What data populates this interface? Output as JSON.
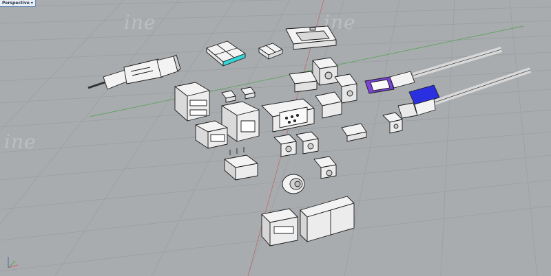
{
  "viewport": {
    "label": "Perspective",
    "menu_icon": "chevron-down-icon",
    "background": "#a9acaf",
    "grid_color": "#9a9da0",
    "x_axis_color": "#b86a6a",
    "y_axis_color": "#5ea45e"
  },
  "watermark": {
    "text": "ine"
  },
  "scene": {
    "objects": [
      "usb-a-plug-cable",
      "micro-sd-card",
      "sd-card-slot",
      "hdmi-receptacle",
      "dc-barrel-jack",
      "usb-a-dual-stack-receptacle",
      "micro-usb-receptacle",
      "rj45-jack",
      "vga-db15-connector",
      "hdmi-port",
      "usb-c-cable-purple",
      "usb-c-cable-blue",
      "usb-a-receptacle",
      "usb-a-through-hole-receptacle",
      "audio-jack",
      "toroidal-inductor",
      "usb-c-receptacle",
      "usb-mini-receptacle",
      "vertical-usb-receptacle",
      "pcie-edge-connector"
    ],
    "accent_cyan": "#35d5d8",
    "accent_purple": "#7a44d6",
    "accent_blue": "#2a2fe0"
  }
}
